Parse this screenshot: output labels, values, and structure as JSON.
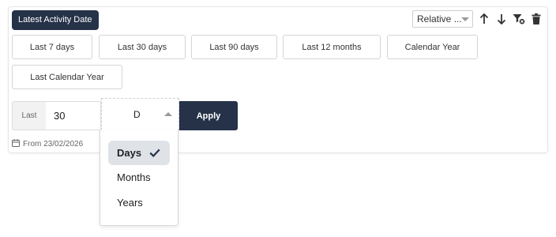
{
  "filter": {
    "title": "Latest Activity Date",
    "mode_select": {
      "value": "Relative ..."
    },
    "presets": [
      {
        "label": "Last 7 days"
      },
      {
        "label": "Last 30 days"
      },
      {
        "label": "Last 90 days"
      },
      {
        "label": "Last 12 months"
      },
      {
        "label": "Calendar Year"
      },
      {
        "label": "Last Calendar Year"
      }
    ],
    "custom": {
      "prefix_label": "Last",
      "amount_value": "30",
      "unit_value": "D",
      "apply_label": "Apply"
    },
    "from_text": "From 23/02/2026"
  },
  "unit_dropdown": {
    "options": [
      {
        "label": "Days",
        "selected": true
      },
      {
        "label": "Months",
        "selected": false
      },
      {
        "label": "Years",
        "selected": false
      }
    ]
  },
  "icons": {
    "mode_caret": "chevron-down-icon",
    "sort_ascending": "arrow-up-icon",
    "sort_descending": "arrow-down-icon",
    "clear_filter": "filter-clear-icon",
    "delete": "trash-icon",
    "calendar": "calendar-icon",
    "unit_caret": "chevron-up-icon",
    "selected_check": "check-icon"
  },
  "colors": {
    "primary_dark": "#253248",
    "selected_option_bg": "#dfe3e8"
  }
}
